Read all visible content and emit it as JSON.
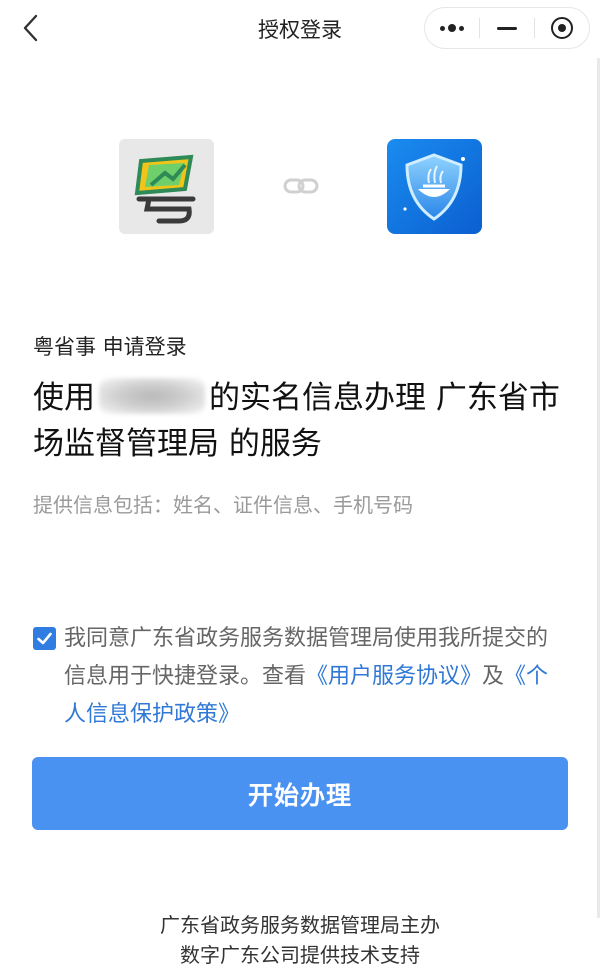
{
  "nav": {
    "title": "授权登录",
    "back_icon": "chevron-left-icon",
    "capsule": [
      "more-icon",
      "minimize-icon",
      "close-target-icon"
    ]
  },
  "logos": {
    "left_app": "粤省事",
    "link_icon": "link-icon",
    "right_app_icon": "shield-icon"
  },
  "request": {
    "requester": "粤省事 申请登录",
    "headline_prefix": "使用",
    "headline_suffix": "的实名信息办理 广东省市场监督管理局 的服务",
    "info": "提供信息包括：姓名、证件信息、手机号码"
  },
  "agreement": {
    "checked": true,
    "text": "我同意广东省政务服务数据管理局使用我所提交的信息用于快捷登录。查看",
    "link_service": "《用户服务协议》",
    "joiner": "及",
    "link_privacy": "《个人信息保护政策》"
  },
  "button": {
    "label": "开始办理"
  },
  "footer": {
    "line1": "广东省政务服务数据管理局主办",
    "line2": "数字广东公司提供技术支持"
  },
  "colors": {
    "accent": "#4a92f2",
    "link": "#2f78d6",
    "checkbox": "#2f7de1"
  }
}
